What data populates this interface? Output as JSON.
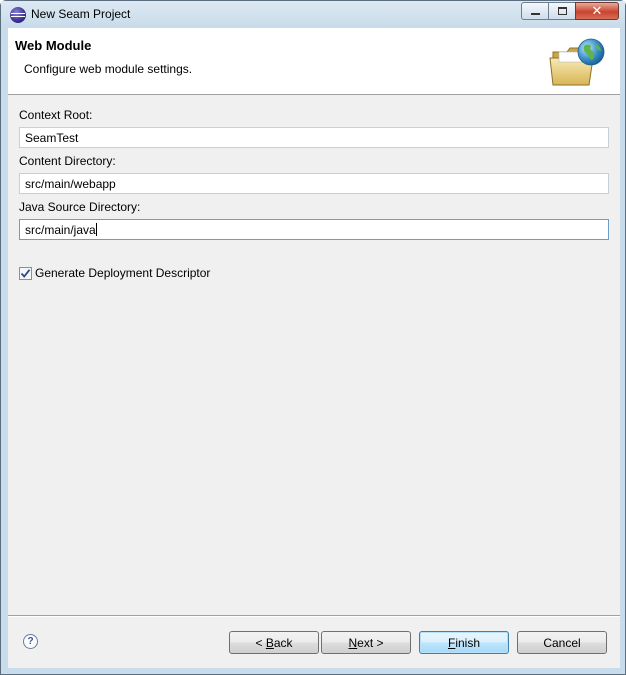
{
  "window": {
    "title": "New Seam Project"
  },
  "banner": {
    "title": "Web Module",
    "description": "Configure web module settings."
  },
  "fields": {
    "context_root": {
      "label": "Context Root:",
      "value": "SeamTest"
    },
    "content_directory": {
      "label": "Content Directory:",
      "value": "src/main/webapp"
    },
    "java_source_directory": {
      "label": "Java Source Directory:",
      "value": "src/main/java"
    }
  },
  "options": {
    "generate_deployment_descriptor": {
      "label": "Generate Deployment Descriptor",
      "checked": true
    }
  },
  "buttons": {
    "help": "?",
    "back_prefix": "< ",
    "back_mnemonic": "B",
    "back_rest": "ack",
    "next_mnemonic": "N",
    "next_rest": "ext >",
    "finish_mnemonic": "F",
    "finish_rest": "inish",
    "cancel": "Cancel"
  },
  "colors": {
    "accent": "#3c7fb1",
    "banner_bg": "#ffffff",
    "body_bg": "#f0f0f0"
  },
  "icons": [
    "eclipse-app-icon",
    "minimize-icon",
    "maximize-icon",
    "close-icon",
    "web-module-folder-globe-icon",
    "checkmark-icon",
    "help-icon"
  ]
}
